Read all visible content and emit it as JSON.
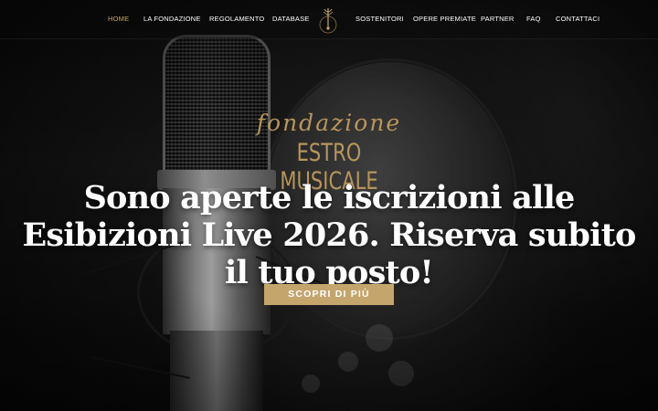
{
  "nav": {
    "left": [
      {
        "label": "HOME",
        "active": true
      },
      {
        "label": "LA FONDAZIONE",
        "active": false
      },
      {
        "label": "REGOLAMENTO",
        "active": false
      },
      {
        "label": "DATABASE",
        "active": false
      }
    ],
    "right": [
      {
        "label": "SOSTENITORI",
        "active": false
      },
      {
        "label": "OPERE PREMIATE",
        "active": false
      },
      {
        "label": "PARTNER",
        "active": false
      },
      {
        "label": "FAQ",
        "active": false
      },
      {
        "label": "CONTATTACI",
        "active": false
      }
    ],
    "logo_icon": "music-tuning-fork-icon"
  },
  "brand": {
    "script": "fondazione",
    "main": "ESTRO MUSICALE"
  },
  "hero": {
    "headline": "Sono aperte le iscrizioni alle Esibizioni Live 2026. Riserva subito il tuo posto!",
    "cta_label": "SCOPRI DI PIÙ"
  },
  "colors": {
    "accent": "#c4a56b",
    "brand_text": "#b8955c",
    "text": "#ffffff"
  }
}
